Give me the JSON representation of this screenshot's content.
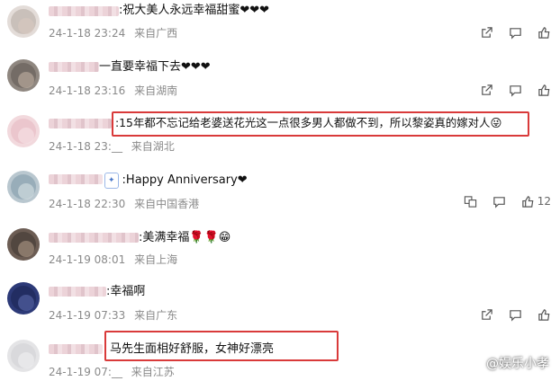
{
  "comments": [
    {
      "text": ":祝大美人永远幸福甜蜜❤❤❤",
      "date": "24-1-18 23:24",
      "location": "来自广西"
    },
    {
      "text": "一直要幸福下去❤❤❤",
      "date": "24-1-18 23:16",
      "location": "来自湖南"
    },
    {
      "text": ":15年都不忘记给老婆送花光这一点很多男人都做不到，所以黎姿真的嫁对人😜",
      "date": "24-1-18 23:__",
      "location": "来自湖北"
    },
    {
      "text": ":Happy Anniversary❤",
      "date": "24-1-18 22:30",
      "location": "来自中国香港",
      "like_count": "12"
    },
    {
      "text": ":美满幸福🌹🌹😁",
      "date": "24-1-19 08:01",
      "location": "来自上海"
    },
    {
      "text": ":幸福啊",
      "date": "24-1-19 07:33",
      "location": "来自广东"
    },
    {
      "text": "马先生面相好舒服，女神好漂亮",
      "date": "24-1-19 07:__",
      "location": "来自江苏"
    }
  ],
  "watermark": "@娱乐小孝",
  "colors": {
    "highlight": "#d93a3a",
    "meta": "#8a8a8a",
    "heart": "#e33b3b"
  },
  "icons": [
    "share-icon",
    "comment-icon",
    "like-icon",
    "translate-icon"
  ]
}
